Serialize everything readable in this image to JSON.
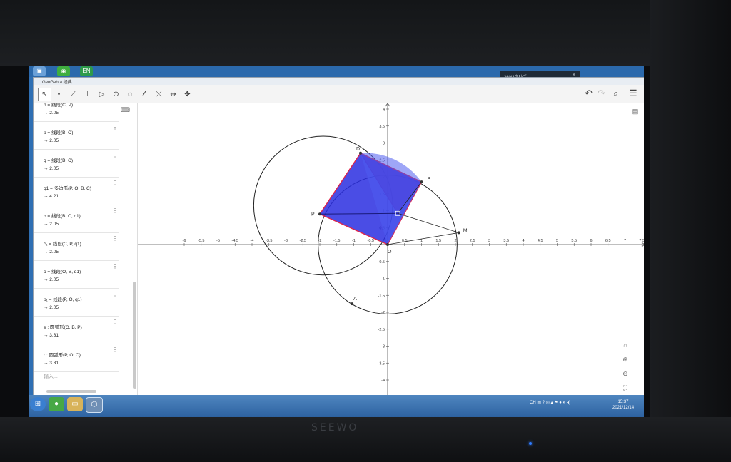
{
  "window_title": "GeoGebra 经典",
  "notification_title": "360U盘助手",
  "notification_close": "×",
  "desktop_tag": "EN",
  "algebra_items": [
    {
      "def": "n = 线段(C, P)",
      "val": "→  2.05"
    },
    {
      "def": "p = 线段(B, O)",
      "val": "→  2.05"
    },
    {
      "def": "q = 线段(B, C)",
      "val": "→  2.05"
    },
    {
      "def": "q1 = 多边形(P, O, B, C)",
      "val": "→  4.21"
    },
    {
      "def": "b = 线段(B, C, q1)",
      "val": "→  2.05"
    },
    {
      "def": "c₁ = 线段(C, P, q1)",
      "val": "→  2.05"
    },
    {
      "def": "o = 线段(O, B, q1)",
      "val": "→  2.05"
    },
    {
      "def": "p₁ = 线段(P, O, q1)",
      "val": "→  2.05"
    },
    {
      "def": "e : 圆弧形(O, B, P)",
      "val": "→  3.31"
    },
    {
      "def": "r : 圆弧形(P, O, C)",
      "val": "→  3.31"
    }
  ],
  "input_placeholder": "输入...",
  "point_labels": {
    "D": "D",
    "B": "B",
    "P": "P",
    "M": "M",
    "O": "O",
    "A": "A"
  },
  "x_ticks": [
    "-6",
    "-5.5",
    "-5",
    "-4.5",
    "-4",
    "-3.5",
    "-3",
    "-2.5",
    "-2",
    "-1.5",
    "-1",
    "-0.5",
    "0.5",
    "1",
    "1.5",
    "2",
    "2.5",
    "3",
    "3.5",
    "4",
    "4.5",
    "5",
    "5.5",
    "6",
    "6.5",
    "7",
    "7.5",
    "8"
  ],
  "y_ticks": [
    "4",
    "3.5",
    "3",
    "2.5",
    "2",
    "1.5",
    "1",
    "0.5",
    "-0.5",
    "-1",
    "-1.5",
    "-2",
    "-2.5",
    "-3",
    "-3.5",
    "-4"
  ],
  "colors": {
    "polygon": "#2a2ee0",
    "triangle": "#e0244a",
    "axis": "#555555",
    "circle": "#222222"
  },
  "tray_text": "CH",
  "clock_time": "15:37",
  "clock_date": "2021/12/14",
  "monitor_brand": "SEEWO"
}
